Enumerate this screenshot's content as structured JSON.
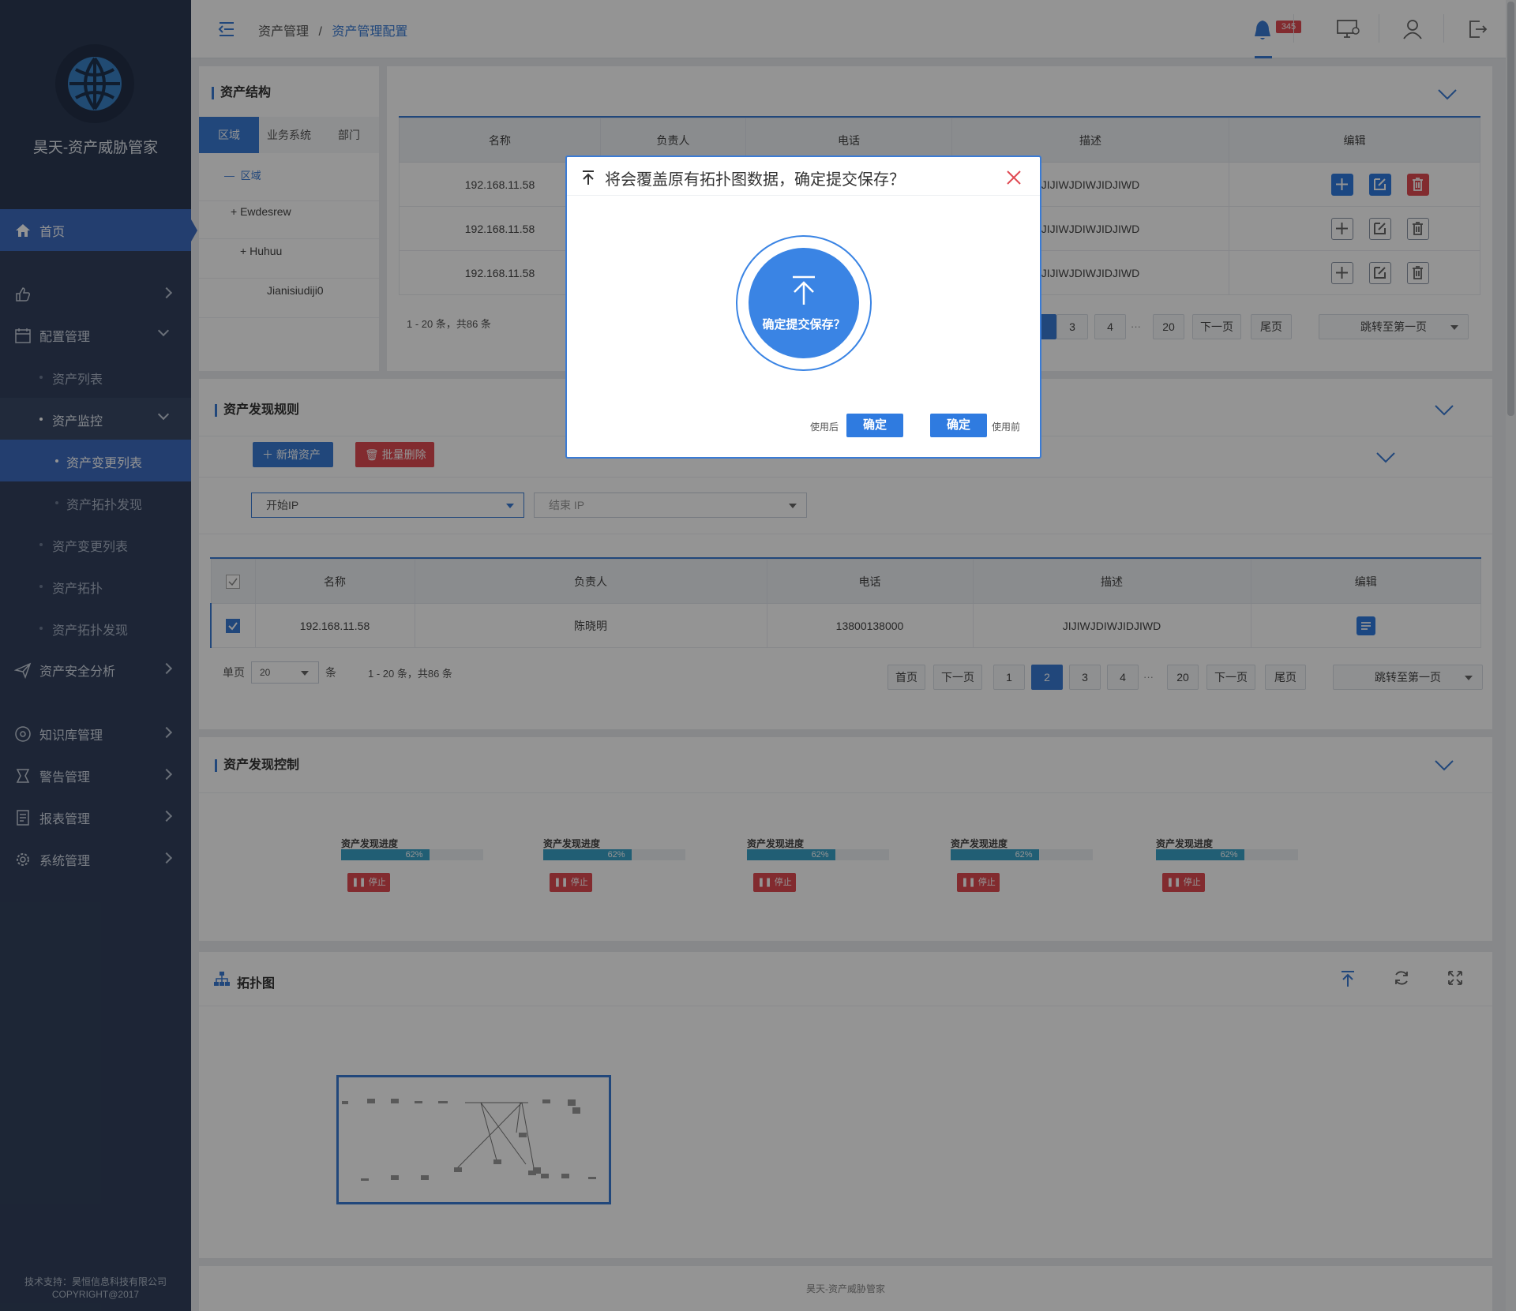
{
  "brand": "昊天-资产威胁管家",
  "footer": {
    "support": "技术支持：昊恒信息科技有限公司",
    "copyright": "COPYRIGHT@2017",
    "center": "昊天-资产威胁管家"
  },
  "nav": {
    "home": "首页",
    "config": "配置管理",
    "asset_list": "资产列表",
    "asset_monitor": "资产监控",
    "asset_change_list_active": "资产变更列表",
    "asset_topo_discover": "资产拓扑发现",
    "asset_change_list": "资产变更列表",
    "asset_topo": "资产拓扑",
    "asset_topo_discover2": "资产拓扑发现",
    "security": "资产安全分析",
    "knowledge": "知识库管理",
    "alert": "警告管理",
    "report": "报表管理",
    "system": "系统管理"
  },
  "breadcrumb": {
    "parent": "资产管理",
    "sep": "/",
    "current": "资产管理配置"
  },
  "notifications": {
    "count": "345"
  },
  "structure": {
    "title": "资产结构",
    "tabs": [
      "区域",
      "业务系统",
      "部门"
    ],
    "tree": {
      "root": "区域",
      "nodes": [
        "Ewdesrew",
        "Huhuu",
        "Jianisiudiji0"
      ]
    }
  },
  "top_table": {
    "headers": [
      "名称",
      "负责人",
      "电话",
      "描述",
      "编辑"
    ],
    "rows": [
      {
        "name": "192.168.11.58",
        "desc": "JIJIWJDIWJIDJIWD"
      },
      {
        "name": "192.168.11.58",
        "desc": "JIJIWJDIWJIDJIWD"
      },
      {
        "name": "192.168.11.58",
        "desc": "JIJIWJDIWJIDJIWD"
      }
    ],
    "summary": "1 - 20 条，共86 条",
    "pages": [
      "3",
      "4",
      "···",
      "20"
    ],
    "next": "下一页",
    "last": "尾页",
    "jump": "跳转至第一页"
  },
  "rules": {
    "title": "资产发现规则",
    "add": "新增资产",
    "batch_delete": "批量删除",
    "start_ip": "开始IP",
    "end_ip": "结束 IP",
    "headers": [
      "名称",
      "负责人",
      "电话",
      "描述",
      "编辑"
    ],
    "row": {
      "name": "192.168.11.58",
      "owner": "陈晓明",
      "phone": "13800138000",
      "desc": "JIJIWJDIWJIDJIWD"
    },
    "page_size_label": "单页",
    "page_size": "20",
    "unit": "条",
    "summary": "1 - 20 条，共86 条",
    "first": "首页",
    "prev": "下一页",
    "pages": [
      "1",
      "2",
      "3",
      "4",
      "···",
      "20"
    ],
    "current_page": "2",
    "next": "下一页",
    "last": "尾页",
    "jump": "跳转至第一页"
  },
  "control": {
    "title": "资产发现控制",
    "items": [
      {
        "label": "资产发现进度",
        "progress": 62,
        "text": "62%",
        "stop": "停止"
      },
      {
        "label": "资产发现进度",
        "progress": 62,
        "text": "62%",
        "stop": "停止"
      },
      {
        "label": "资产发现进度",
        "progress": 62,
        "text": "62%",
        "stop": "停止"
      },
      {
        "label": "资产发现进度",
        "progress": 62,
        "text": "62%",
        "stop": "停止"
      },
      {
        "label": "资产发现进度",
        "progress": 62,
        "text": "62%",
        "stop": "停止"
      }
    ]
  },
  "topology": {
    "title": "拓扑图"
  },
  "modal": {
    "title": "将会覆盖原有拓扑图数据，确定提交保存？",
    "center_label": "确定提交保存？",
    "after_label": "使用后",
    "confirm_after": "确定",
    "confirm_before": "确定",
    "before_label": "使用前"
  },
  "colors": {
    "primary": "#3a7bd5",
    "sidebar": "#32415d",
    "danger": "#e04a52",
    "progress": "#3aa3c9"
  }
}
